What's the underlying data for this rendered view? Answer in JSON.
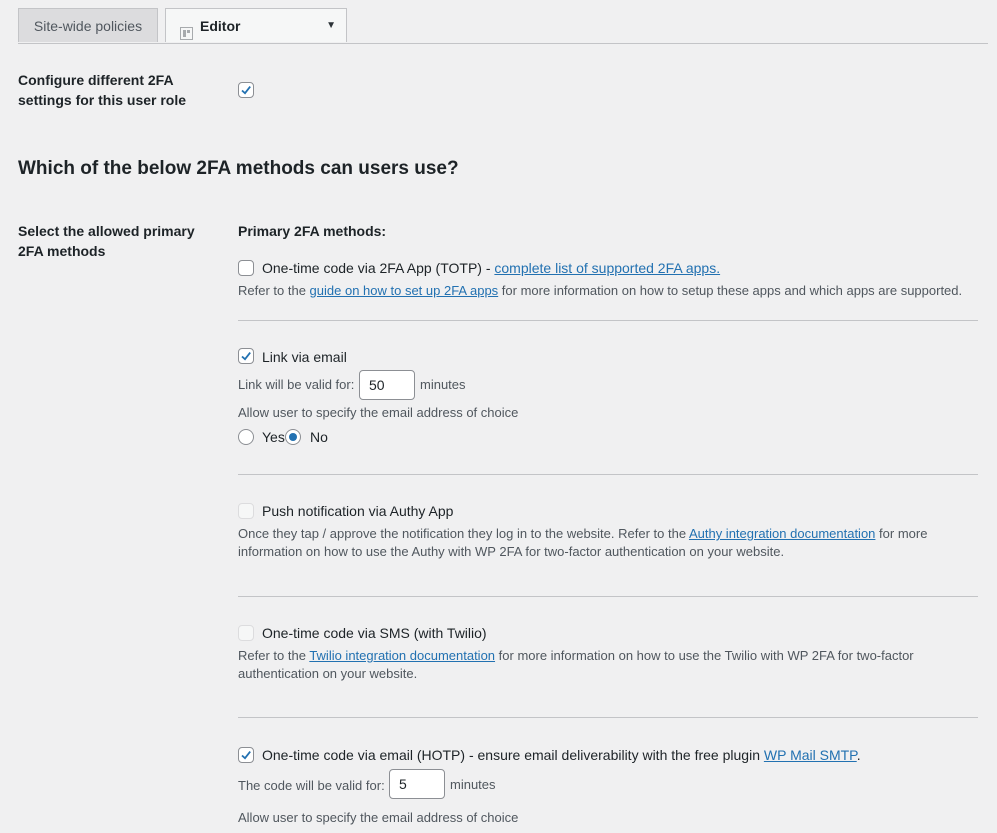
{
  "tabs": {
    "site_wide": "Site-wide policies",
    "editor": "Editor"
  },
  "role_settings": {
    "label": "Configure different 2FA settings for this user role",
    "checked": true
  },
  "section_title": "Which of the below 2FA methods can users use?",
  "methods_label": "Select the allowed primary 2FA methods",
  "primary_heading": "Primary 2FA methods:",
  "totp": {
    "label": "One-time code via 2FA App (TOTP) - ",
    "link": "complete list of supported 2FA apps.",
    "desc_pre": "Refer to the ",
    "desc_link": "guide on how to set up 2FA apps",
    "desc_post": " for more information on how to setup these apps and which apps are supported."
  },
  "email_link": {
    "label": "Link via email",
    "valid_label": "Link will be valid for:",
    "valid_value": "50",
    "unit": "minutes",
    "allow_label": "Allow user to specify the email address of choice",
    "yes": "Yes",
    "no": "No"
  },
  "authy": {
    "label": "Push notification via Authy App",
    "desc_pre": "Once they tap / approve the notification they log in to the website. Refer to the ",
    "desc_link": "Authy integration documentation",
    "desc_post": " for more information on how to use the Authy with WP 2FA for two-factor authentication on your website."
  },
  "sms": {
    "label": "One-time code via SMS (with Twilio)",
    "desc_pre": "Refer to the ",
    "desc_link": "Twilio integration documentation",
    "desc_post": " for more information on how to use the Twilio with WP 2FA for two-factor authentication on your website."
  },
  "hotp": {
    "label": "One-time code via email (HOTP) - ensure email deliverability with the free plugin ",
    "link": "WP Mail SMTP",
    "link_after": ".",
    "valid_label": "The code will be valid for:",
    "valid_value": "5",
    "unit": "minutes",
    "allow_label": "Allow user to specify the email address of choice"
  },
  "colors": {
    "background": "#f0f0f1",
    "link": "#2271b1",
    "checkbox_check": "#2271b1"
  }
}
